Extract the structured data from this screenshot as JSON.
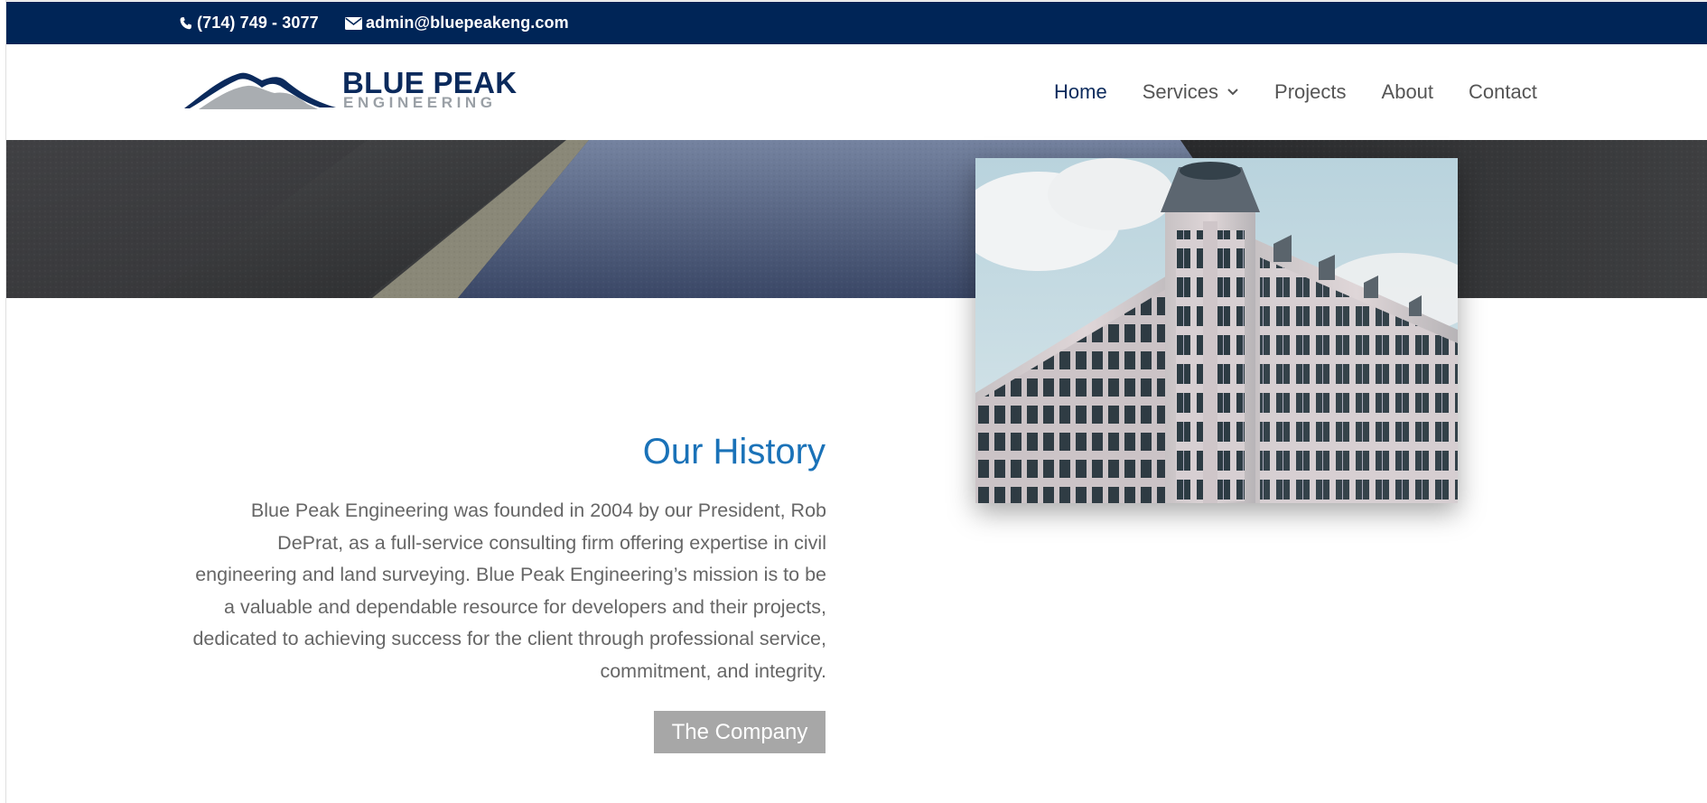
{
  "topbar": {
    "phone": "(714) 749 - 3077",
    "email": "admin@bluepeakeng.com",
    "phone_icon": "phone-icon",
    "email_icon": "envelope-icon"
  },
  "logo": {
    "line1": "BLUE PEAK",
    "line2": "ENGINEERING"
  },
  "nav": {
    "items": [
      {
        "label": "Home",
        "active": true
      },
      {
        "label": "Services",
        "has_dropdown": true
      },
      {
        "label": "Projects"
      },
      {
        "label": "About"
      },
      {
        "label": "Contact"
      }
    ]
  },
  "history": {
    "title": "Our History",
    "body": "Blue Peak Engineering was founded in 2004 by our President, Rob DePrat, as a full-service consulting firm offering expertise in civil engineering and land surveying.  Blue Peak Engineering’s mission is to be a valuable and dependable resource for developers and their projects, dedicated to achieving success for the client through professional service, commitment, and integrity.",
    "button_label": "The Company"
  },
  "colors": {
    "topbar_bg": "#002557",
    "accent": "#1a72b8",
    "nav_active": "#0b2a5c",
    "button_bg": "#a7a7a7"
  }
}
